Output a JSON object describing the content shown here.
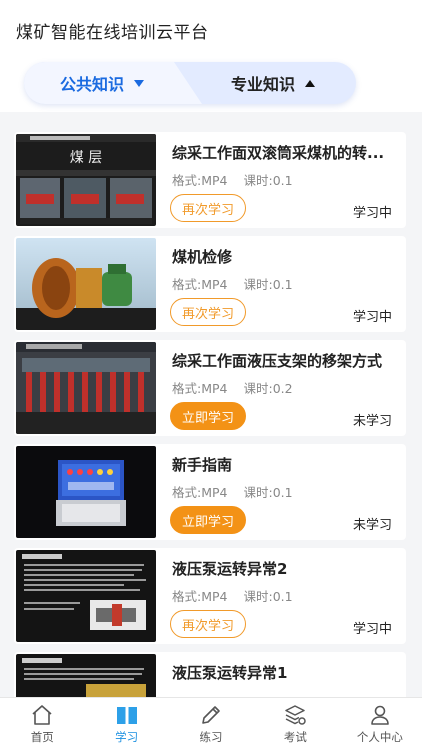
{
  "header": {
    "title": "煤矿智能在线培训云平台"
  },
  "segment": {
    "left_label": "公共知识",
    "right_label": "专业知识"
  },
  "courses": [
    {
      "title": "综采工作面双滚筒采煤机的转...",
      "format": "格式:MP4",
      "hours": "课时:0.1",
      "button": "再次学习",
      "button_style": "outline",
      "status": "学习中",
      "thumb_caption": "煤 层"
    },
    {
      "title": "煤机检修",
      "format": "格式:MP4",
      "hours": "课时:0.1",
      "button": "再次学习",
      "button_style": "outline",
      "status": "学习中"
    },
    {
      "title": "综采工作面液压支架的移架方式",
      "format": "格式:MP4",
      "hours": "课时:0.2",
      "button": "立即学习",
      "button_style": "solid",
      "status": "未学习"
    },
    {
      "title": "新手指南",
      "format": "格式:MP4",
      "hours": "课时:0.1",
      "button": "立即学习",
      "button_style": "solid",
      "status": "未学习"
    },
    {
      "title": "液压泵运转异常2",
      "format": "格式:MP4",
      "hours": "课时:0.1",
      "button": "再次学习",
      "button_style": "outline",
      "status": "学习中"
    },
    {
      "title": "液压泵运转异常1",
      "format": "",
      "hours": "",
      "button": "",
      "button_style": "outline",
      "status": ""
    }
  ],
  "tabbar": {
    "items": [
      {
        "label": "首页",
        "icon": "home-icon"
      },
      {
        "label": "学习",
        "icon": "book-icon"
      },
      {
        "label": "练习",
        "icon": "pencil-icon"
      },
      {
        "label": "考试",
        "icon": "exam-icon"
      },
      {
        "label": "个人中心",
        "icon": "user-icon"
      }
    ],
    "active_index": 1
  },
  "colors": {
    "accent_blue": "#1a6ae0",
    "tab_active": "#1a8fe0",
    "orange": "#f39216"
  }
}
